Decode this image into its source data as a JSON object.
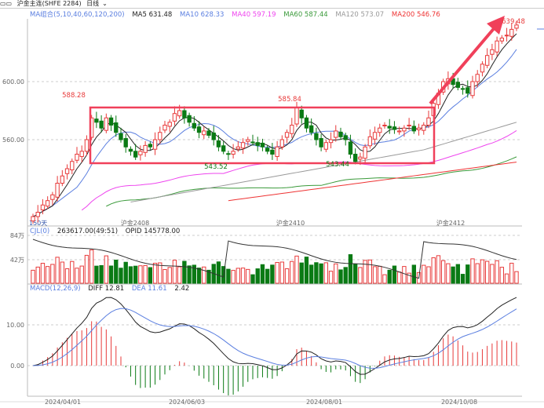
{
  "header": {
    "title": "沪金主连(SHFE 2284)",
    "period": "日线"
  },
  "ma_legend": {
    "label": "MA组合(5,10,40,60,120,200)",
    "ma5": "MA5 631.48",
    "ma10": "MA10 628.33",
    "ma40": "MA40 597.19",
    "ma60": "MA60 587.44",
    "ma120": "MA120 573.07",
    "ma200": "MA200 546.76"
  },
  "vol_legend": {
    "label": "CJL(0)",
    "vol": "263617.00(49:51)",
    "opid": "OPID 145778.00"
  },
  "macd_legend": {
    "label": "MACD(12,26,9)",
    "diff": "DIFF 12.81",
    "dea": "DEA 11.61",
    "macd": "2.42"
  },
  "colors": {
    "up": "#e83a3a",
    "down": "#0a7a14",
    "ma5": "#222222",
    "ma10": "#5b7fe0",
    "ma40": "#ee44ee",
    "ma60": "#3a9a3a",
    "ma120": "#999999",
    "ma200": "#ee3333",
    "highlight": "#f0405a"
  },
  "chart_data": {
    "type": "candlestick",
    "price_ticks": [
      "600.00",
      "560.00"
    ],
    "vol_ticks": [
      "84万",
      "42万"
    ],
    "macd_ticks": [
      "10.00",
      "0.00"
    ],
    "date_ticks": [
      "2024/04/01",
      "2024/06/03",
      "2024/08/01",
      "2024/10/08"
    ],
    "contract_labels": [
      "沪金2408",
      "沪金2410",
      "沪金2412"
    ],
    "span_label": "150天",
    "annotations": {
      "high1": "588.28",
      "high2": "585.84",
      "low1": "543.52",
      "low2": "543.44",
      "last": "639.48"
    },
    "closes": [
      507,
      510,
      515,
      518,
      522,
      530,
      535,
      540,
      545,
      550,
      552,
      560,
      575,
      572,
      568,
      575,
      570,
      565,
      560,
      555,
      552,
      548,
      552,
      556,
      555,
      560,
      565,
      570,
      572,
      578,
      580,
      575,
      572,
      568,
      565,
      566,
      563,
      560,
      555,
      552,
      550,
      552,
      555,
      558,
      560,
      558,
      556,
      555,
      552,
      550,
      555,
      560,
      565,
      570,
      582,
      575,
      568,
      565,
      560,
      555,
      558,
      560,
      566,
      562,
      560,
      550,
      545,
      548,
      555,
      562,
      565,
      568,
      570,
      568,
      567,
      566,
      568,
      570,
      566,
      568,
      570,
      575,
      585,
      592,
      600,
      602,
      598,
      596,
      595,
      592,
      600,
      605,
      612,
      618,
      622,
      628,
      630,
      632,
      636,
      639
    ]
  }
}
